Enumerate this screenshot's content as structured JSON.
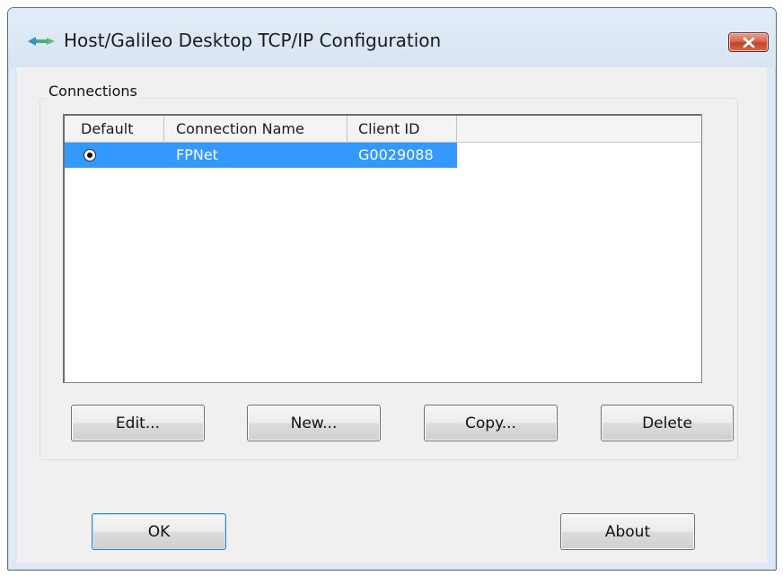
{
  "window": {
    "title": "Host/Galileo Desktop TCP/IP Configuration"
  },
  "connections": {
    "group_label": "Connections",
    "columns": [
      "Default",
      "Connection Name",
      "Client ID"
    ],
    "rows": [
      {
        "default_selected": true,
        "connection_name": "FPNet",
        "client_id": "G0029088"
      }
    ]
  },
  "buttons": {
    "edit": "Edit...",
    "new": "New...",
    "copy": "Copy...",
    "delete": "Delete",
    "ok": "OK",
    "about": "About"
  },
  "colors": {
    "selection": "#3399ff",
    "window_frame": "#dfe9f5",
    "close_button": "#c2432a"
  },
  "icons": {
    "app": "network-arrows-icon",
    "close": "close-icon",
    "default_radio": "radio-selected-icon"
  }
}
